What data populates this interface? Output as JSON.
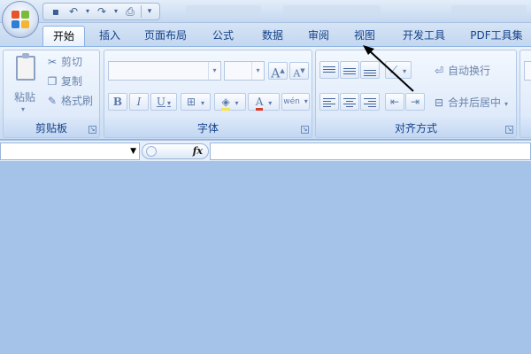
{
  "colors": {
    "accent": "#15428b",
    "workspace": "#a5c3e8",
    "tab_active_bg": "#ffffff"
  },
  "quick_access": {
    "icons": [
      "save-icon",
      "undo-icon",
      "redo-icon",
      "print-preview-icon"
    ]
  },
  "tabs": [
    {
      "id": "home",
      "label": "开始",
      "active": true
    },
    {
      "id": "insert",
      "label": "插入"
    },
    {
      "id": "page-layout",
      "label": "页面布局"
    },
    {
      "id": "formulas",
      "label": "公式"
    },
    {
      "id": "data",
      "label": "数据"
    },
    {
      "id": "review",
      "label": "审阅"
    },
    {
      "id": "view",
      "label": "视图"
    },
    {
      "id": "developer",
      "label": "开发工具"
    },
    {
      "id": "pdf",
      "label": "PDF工具集"
    }
  ],
  "clipboard": {
    "paste_label": "粘贴",
    "cut_label": "剪切",
    "copy_label": "复制",
    "format_painter_label": "格式刷",
    "group_label": "剪贴板"
  },
  "font": {
    "font_name_value": "",
    "font_size_value": "",
    "grow_label": "A",
    "shrink_label": "A",
    "bold_label": "B",
    "italic_label": "I",
    "underline_label": "U",
    "border_label": "⊞",
    "phonetic_label": "wén",
    "group_label": "字体"
  },
  "alignment": {
    "wrap_text_label": "自动换行",
    "merge_center_label": "合并后居中",
    "group_label": "对齐方式"
  },
  "formula_bar": {
    "name_box_value": "",
    "fx_label": "fx",
    "formula_value": ""
  }
}
